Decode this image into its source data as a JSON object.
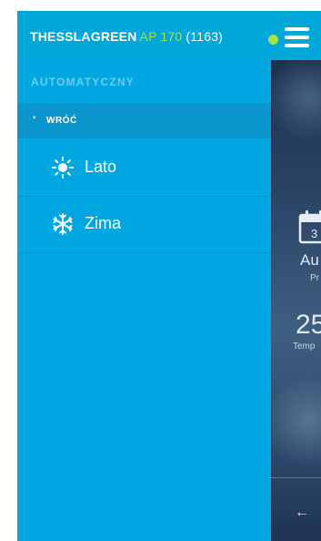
{
  "header": {
    "brand": "THESSLAGREEN",
    "model": "AP 170",
    "serial": "(1163)",
    "status_color": "#a6e24a",
    "menu_icon": "hamburger-menu-icon"
  },
  "drawer": {
    "section_title": "AUTOMATYCZNY",
    "back_label": "WRÓĆ",
    "back_bullet": "•",
    "items": [
      {
        "label": "Lato",
        "icon": "sun-icon"
      },
      {
        "label": "Zima",
        "icon": "snowflake-icon"
      }
    ]
  },
  "background": {
    "calendar_day": "3",
    "mode_text": "Au",
    "mode_sub": "Pr",
    "temperature": "25",
    "temperature_label": "Temp",
    "back_arrow": "←"
  },
  "colors": {
    "accent": "#00a7e1",
    "header": "#00a7d8",
    "back_row": "#0a95cc"
  }
}
